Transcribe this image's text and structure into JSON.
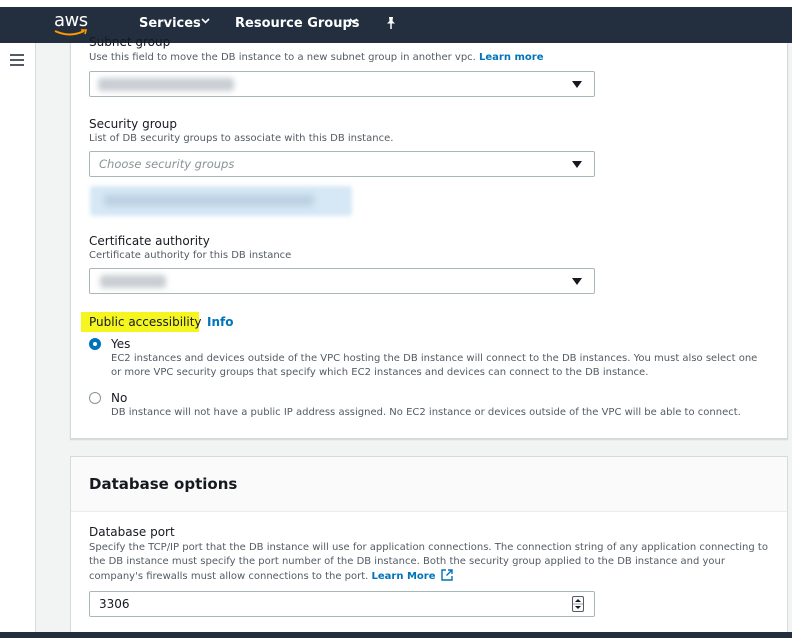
{
  "nav": {
    "logo_text": "aws",
    "services_label": "Services",
    "resource_groups_label": "Resource Groups"
  },
  "subnet_group": {
    "label": "Subnet group",
    "description": "Use this field to move the DB instance to a new subnet group in another vpc.",
    "link": "Learn more"
  },
  "security_group": {
    "label": "Security group",
    "description": "List of DB security groups to associate with this DB instance.",
    "placeholder": "Choose security groups"
  },
  "certificate_authority": {
    "label": "Certificate authority",
    "description": "Certificate authority for this DB instance"
  },
  "public_accessibility": {
    "label": "Public accessibility",
    "info_link": "Info",
    "selected": "Yes",
    "options": [
      {
        "label": "Yes",
        "description": "EC2 instances and devices outside of the VPC hosting the DB instance will connect to the DB instances. You must also select one or more VPC security groups that specify which EC2 instances and devices can connect to the DB instance."
      },
      {
        "label": "No",
        "description": "DB instance will not have a public IP address assigned. No EC2 instance or devices outside of the VPC will be able to connect."
      }
    ]
  },
  "database_options": {
    "title": "Database options",
    "port_label": "Database port",
    "port_description": "Specify the TCP/IP port that the DB instance will use for application connections. The connection string of any application connecting to the DB instance must specify the port number of the DB instance. Both the security group applied to the DB instance and your company's firewalls must allow connections to the port.",
    "port_link": "Learn More",
    "port_value": "3306"
  },
  "colors": {
    "nav_bg": "#232f3e",
    "link": "#0073bb",
    "highlight": "#f5f520",
    "aws_orange": "#ff9900"
  }
}
